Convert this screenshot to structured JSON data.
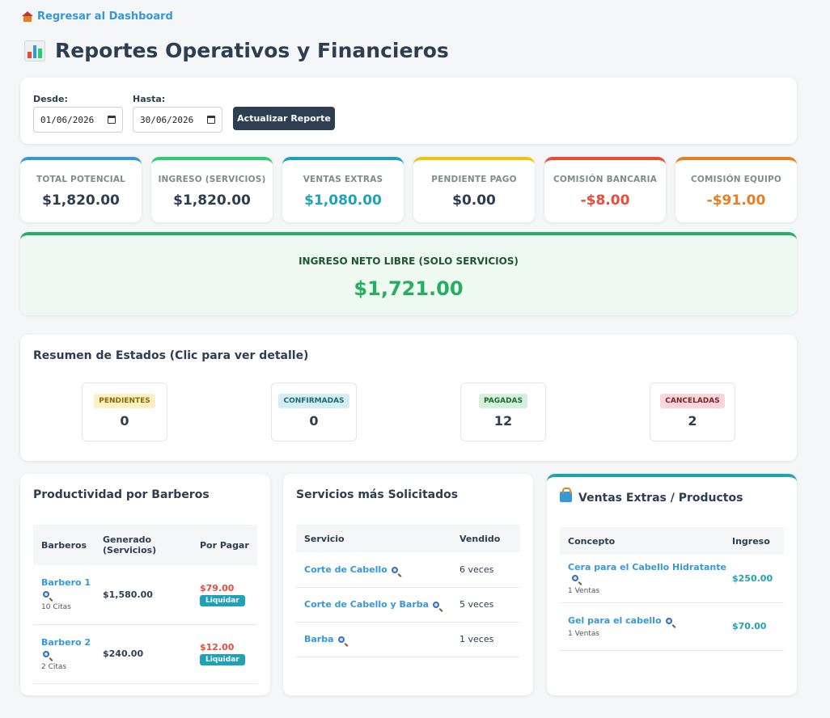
{
  "nav": {
    "back_label": "Regresar al Dashboard"
  },
  "page": {
    "title": "Reportes Operativos y Financieros"
  },
  "filters": {
    "from_label": "Desde:",
    "from_value": "01/06/2026",
    "to_label": "Hasta:",
    "to_value": "30/06/2026",
    "update_button": "Actualizar Reporte"
  },
  "kpis": [
    {
      "label": "TOTAL POTENCIAL",
      "value": "$1,820.00",
      "color": "#3498db",
      "value_color": "#2c3e50"
    },
    {
      "label": "INGRESO (SERVICIOS)",
      "value": "$1,820.00",
      "color": "#2ecc71",
      "value_color": "#2c3e50"
    },
    {
      "label": "VENTAS EXTRAS",
      "value": "$1,080.00",
      "color": "#1fa2b7",
      "value_color": "#1fa2b7"
    },
    {
      "label": "PENDIENTE PAGO",
      "value": "$0.00",
      "color": "#f1c40f",
      "value_color": "#2c3e50"
    },
    {
      "label": "COMISIÓN BANCARIA",
      "value": "-$8.00",
      "color": "#e74c3c",
      "value_color": "#e74c3c"
    },
    {
      "label": "COMISIÓN EQUIPO",
      "value": "-$91.00",
      "color": "#e67e22",
      "value_color": "#e67e22"
    }
  ],
  "net_income": {
    "label": "INGRESO NETO LIBRE (SOLO SERVICIOS)",
    "value": "$1,721.00"
  },
  "status_summary": {
    "title": "Resumen de Estados (Clic para ver detalle)",
    "items": [
      {
        "label": "PENDIENTES",
        "count": "0",
        "bg": "#fdf0c4",
        "fg": "#8a6d00"
      },
      {
        "label": "CONFIRMADAS",
        "count": "0",
        "bg": "#d4eef1",
        "fg": "#1a6b78"
      },
      {
        "label": "PAGADAS",
        "count": "12",
        "bg": "#d5f1dc",
        "fg": "#1e6b35"
      },
      {
        "label": "CANCELADAS",
        "count": "2",
        "bg": "#f8d7da",
        "fg": "#842029"
      }
    ]
  },
  "barbers": {
    "title": "Productividad por Barberos",
    "headers": [
      "Barberos",
      "Generado (Servicios)",
      "Por Pagar"
    ],
    "rows": [
      {
        "name": "Barbero 1",
        "citas": "10 Citas",
        "generated": "$1,580.00",
        "pending": "$79.00",
        "action": "Liquidar"
      },
      {
        "name": "Barbero 2",
        "citas": "2 Citas",
        "generated": "$240.00",
        "pending": "$12.00",
        "action": "Liquidar"
      }
    ]
  },
  "services": {
    "title": "Servicios más Solicitados",
    "headers": [
      "Servicio",
      "Vendido"
    ],
    "rows": [
      {
        "name": "Corte de Cabello",
        "count": "6 veces"
      },
      {
        "name": "Corte de Cabello y Barba",
        "count": "5 veces"
      },
      {
        "name": "Barba",
        "count": "1 veces"
      }
    ]
  },
  "extras": {
    "title": "Ventas Extras / Productos",
    "headers": [
      "Concepto",
      "Ingreso"
    ],
    "rows": [
      {
        "name": "Cera para el Cabello Hidratante",
        "sales": "1 Ventas",
        "income": "$250.00"
      },
      {
        "name": "Gel para el cabello",
        "sales": "1 Ventas",
        "income": "$70.00"
      }
    ]
  }
}
